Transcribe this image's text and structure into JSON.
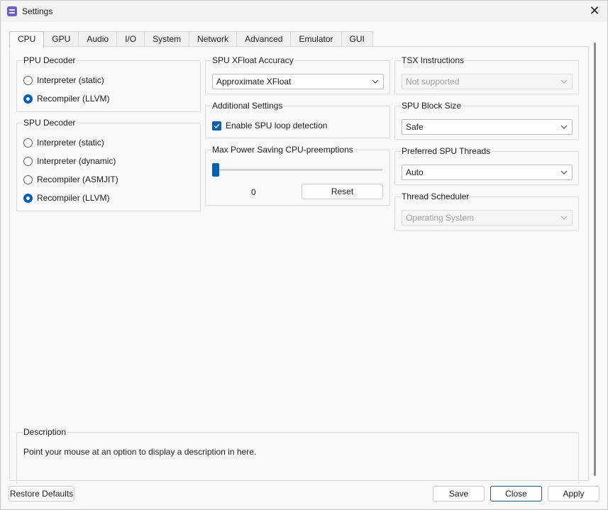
{
  "window": {
    "title": "Settings",
    "close_glyph": "✕"
  },
  "tabs": [
    {
      "label": "CPU",
      "active": true
    },
    {
      "label": "GPU"
    },
    {
      "label": "Audio"
    },
    {
      "label": "I/O"
    },
    {
      "label": "System"
    },
    {
      "label": "Network"
    },
    {
      "label": "Advanced"
    },
    {
      "label": "Emulator"
    },
    {
      "label": "GUI"
    }
  ],
  "ppu_decoder": {
    "title": "PPU Decoder",
    "options": [
      "Interpreter (static)",
      "Recompiler (LLVM)"
    ],
    "selected": "Recompiler (LLVM)"
  },
  "spu_decoder": {
    "title": "SPU Decoder",
    "options": [
      "Interpreter (static)",
      "Interpreter (dynamic)",
      "Recompiler (ASMJIT)",
      "Recompiler (LLVM)"
    ],
    "selected": "Recompiler (LLVM)"
  },
  "spu_xfloat": {
    "title": "SPU XFloat Accuracy",
    "value": "Approximate XFloat"
  },
  "additional_settings": {
    "title": "Additional Settings",
    "enable_spu_loop_detection": {
      "label": "Enable SPU loop detection",
      "checked": true
    }
  },
  "max_power_saving": {
    "title": "Max Power Saving CPU-preemptions",
    "slider_value": 0,
    "value_text": "0",
    "reset_label": "Reset"
  },
  "tsx": {
    "title": "TSX Instructions",
    "value": "Not supported",
    "disabled": true
  },
  "spu_block_size": {
    "title": "SPU Block Size",
    "value": "Safe"
  },
  "preferred_spu_threads": {
    "title": "Preferred SPU Threads",
    "value": "Auto"
  },
  "thread_scheduler": {
    "title": "Thread Scheduler",
    "value": "Operating System",
    "disabled": true
  },
  "description": {
    "title": "Description",
    "text": "Point your mouse at an option to display a description in here."
  },
  "footer": {
    "restore_defaults": "Restore Defaults",
    "save": "Save",
    "close": "Close",
    "apply": "Apply"
  },
  "colors": {
    "accent": "#005fb8",
    "border": "#dcdcdc",
    "window_bg": "#f9f9f9"
  }
}
